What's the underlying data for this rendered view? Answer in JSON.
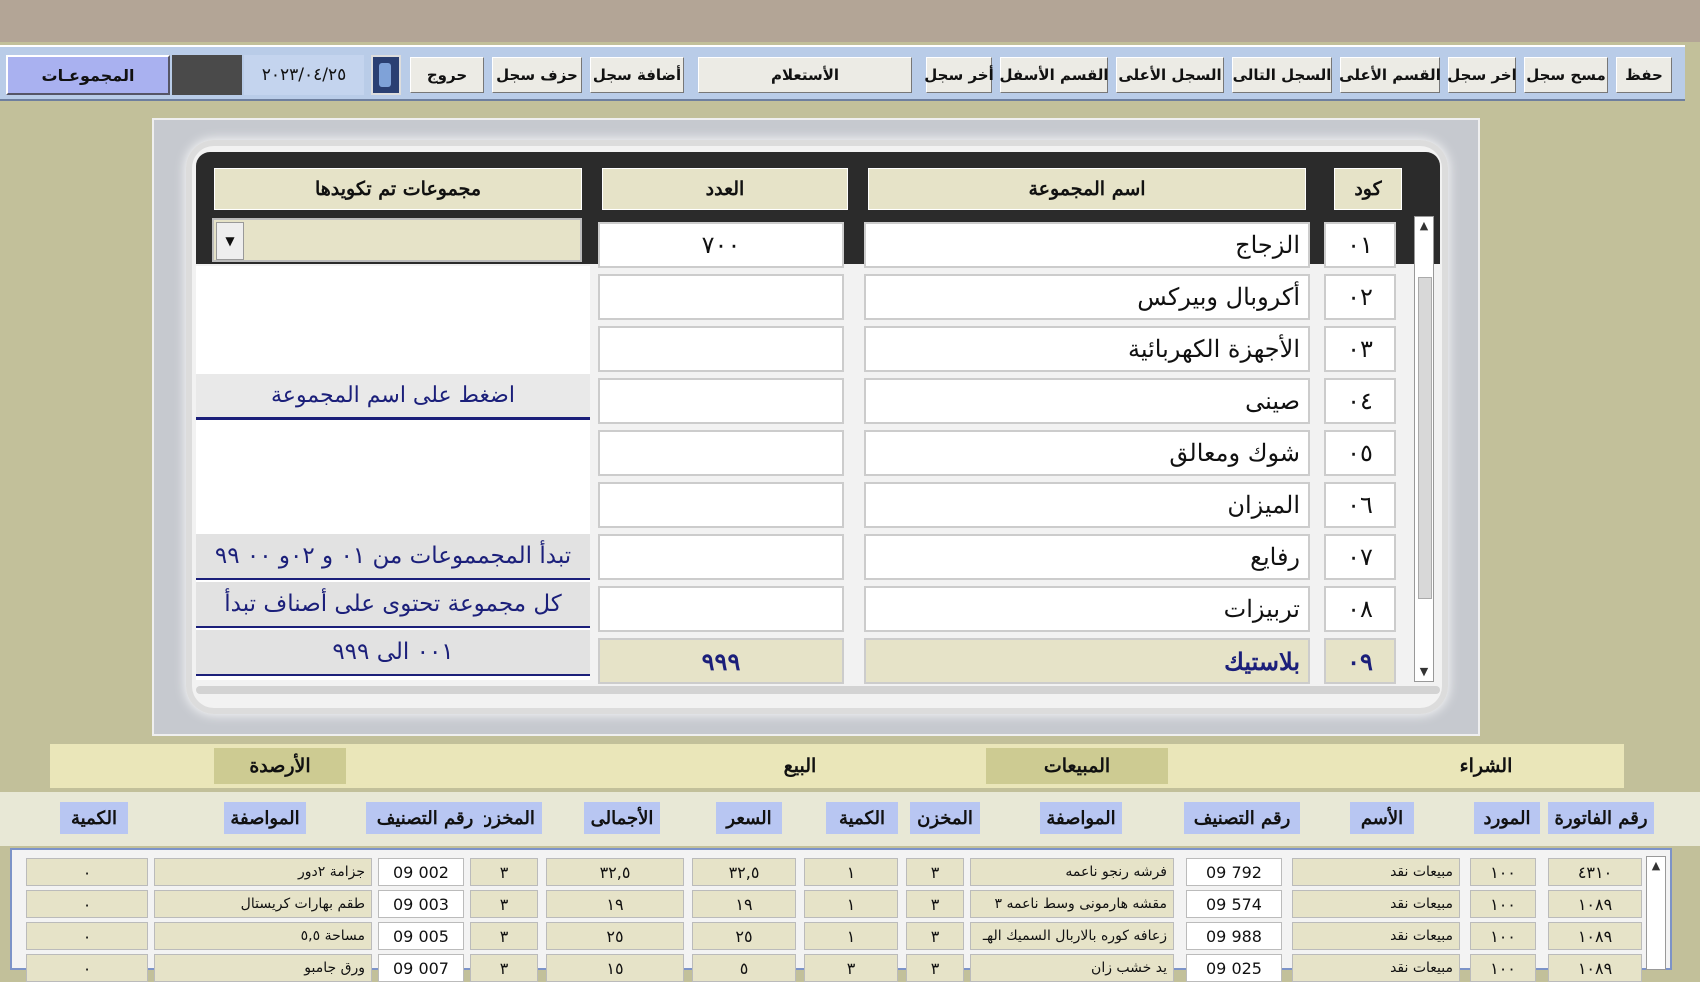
{
  "toolbar": {
    "buttons": [
      "حفظ",
      "مسح سجل",
      "اخر سجل",
      "القسم الأعلى",
      "السجل التالى",
      "السجل الأعلى",
      "القسم الأسفل",
      "أخر سجل",
      "الأستعلام",
      "أضافة سجل",
      "حزف سجل",
      "حروج"
    ],
    "date": "٢٠٢٣/٠٤/٢٥",
    "form_title": "المجموعـات"
  },
  "grid": {
    "headers": {
      "code": "كود",
      "name": "اسم المجموعة",
      "count": "العدد",
      "coded": "مجموعات تم تكويدها"
    },
    "rows": [
      {
        "code": "٠١",
        "name": "الزجاج",
        "count": "٧٠٠"
      },
      {
        "code": "٠٢",
        "name": "أكروبال وبيركس",
        "count": ""
      },
      {
        "code": "٠٣",
        "name": "الأجهزة الكهربائية",
        "count": ""
      },
      {
        "code": "٠٤",
        "name": "صينى",
        "count": ""
      },
      {
        "code": "٠٥",
        "name": "شوك ومعالق",
        "count": ""
      },
      {
        "code": "٠٦",
        "name": "الميزان",
        "count": ""
      },
      {
        "code": "٠٧",
        "name": "رفايع",
        "count": ""
      },
      {
        "code": "٠٨",
        "name": "تربيزات",
        "count": ""
      },
      {
        "code": "٠٩",
        "name": "بلاستيك",
        "count": "٩٩٩"
      }
    ],
    "press_button": "اضغط على اسم المجموعة",
    "notes": [
      "تبدأ المجمموعات من ٠١ و ٠٢و ٠٠ ٩٩",
      "كل مجموعة تحتوى على أصناف تبدأ",
      "٠٠١ الى ٩٩٩"
    ]
  },
  "sections": {
    "purchase": "الشراء",
    "sales": "المبيعات",
    "sell": "البيع",
    "balances": "الأرصدة"
  },
  "columns": [
    "رقم الفاتورة",
    "المورد",
    "الأسم",
    "رقم التصنيف",
    "المواصفة",
    "المخزن",
    "الكمية",
    "السعر",
    "الأجمالى",
    "المخزن",
    "رقم التصنيف",
    "المواصفة",
    "الكمية"
  ],
  "table_rows": [
    {
      "invoice": "٤٣١٠",
      "supplier": "١٠٠",
      "name": "مبيعات نقد",
      "class": "09 792",
      "spec": "فرشه رنجو ناعمه",
      "store": "٣",
      "qty": "١",
      "price": "٣٢,٥",
      "total": "٣٢,٥",
      "store2": "٣",
      "class2": "09 002",
      "spec2": "جزامة ٢دور",
      "qty2": "٠"
    },
    {
      "invoice": "١٠٨٩",
      "supplier": "١٠٠",
      "name": "مبيعات نقد",
      "class": "09 574",
      "spec": "مقشه هارمونى وسط ناعمه ٣",
      "store": "٣",
      "qty": "١",
      "price": "١٩",
      "total": "١٩",
      "store2": "٣",
      "class2": "09 003",
      "spec2": "طقم بهارات كريستال",
      "qty2": "٠"
    },
    {
      "invoice": "١٠٨٩",
      "supplier": "١٠٠",
      "name": "مبيعات نقد",
      "class": "09 988",
      "spec": "زعافه كوره بالاربال السميك الهـ",
      "store": "٣",
      "qty": "١",
      "price": "٢٥",
      "total": "٢٥",
      "store2": "٣",
      "class2": "09 005",
      "spec2": "مساحة ٥,٥",
      "qty2": "٠"
    },
    {
      "invoice": "١٠٨٩",
      "supplier": "١٠٠",
      "name": "مبيعات نقد",
      "class": "09 025",
      "spec": "يد خشب زان",
      "store": "٣",
      "qty": "٣",
      "price": "٥",
      "total": "١٥",
      "store2": "٣",
      "class2": "09 007",
      "spec2": "ورق جامبو",
      "qty2": "٠"
    }
  ]
}
